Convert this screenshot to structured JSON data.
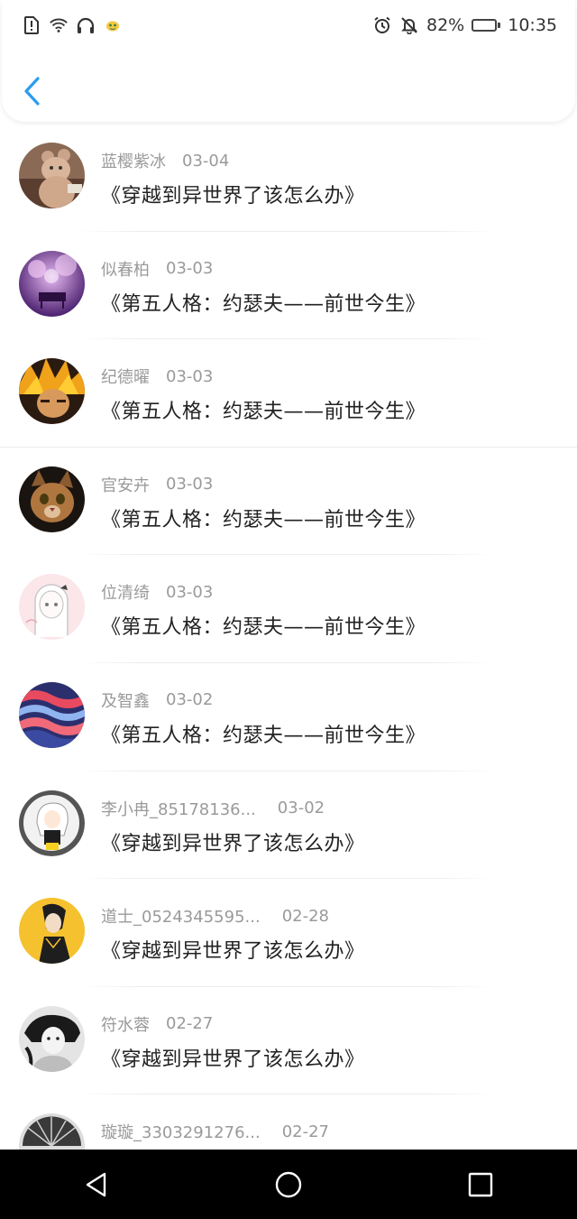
{
  "status_bar": {
    "battery": "82%",
    "battery_level": 0.82,
    "time": "10:35",
    "icons_left": [
      "sim-alert-icon",
      "wifi-icon",
      "headphones-icon",
      "app-notification-icon"
    ],
    "icons_right": [
      "alarm-icon",
      "notifications-muted-icon",
      "battery-icon"
    ]
  },
  "header": {
    "back_icon": "chevron-left-icon",
    "accent_color": "#2b9cf0"
  },
  "items": [
    {
      "name": "蓝樱紫冰",
      "date": "03-04",
      "title": "《穿越到异世界了该怎么办》",
      "avatar": "teddy-bear-avatar"
    },
    {
      "name": "似春柏",
      "date": "03-03",
      "title": "《第五人格：约瑟夫——前世今生》",
      "avatar": "purple-piano-avatar"
    },
    {
      "name": "纪德曜",
      "date": "03-03",
      "title": "《第五人格：约瑟夫——前世今生》",
      "avatar": "anime-blond-avatar"
    },
    {
      "name": "官安卉",
      "date": "03-03",
      "title": "《第五人格：约瑟夫——前世今生》",
      "avatar": "kitten-avatar"
    },
    {
      "name": "位清绮",
      "date": "03-03",
      "title": "《第五人格：约瑟夫——前世今生》",
      "avatar": "anime-girl-sketch-avatar"
    },
    {
      "name": "及智鑫",
      "date": "03-02",
      "title": "《第五人格：约瑟夫——前世今生》",
      "avatar": "wave-pattern-avatar"
    },
    {
      "name": "李小冉_85178136...",
      "date": "03-02",
      "title": "《穿越到异世界了该怎么办》",
      "avatar": "anime-white-hair-avatar"
    },
    {
      "name": "道士_0524345595...",
      "date": "02-28",
      "title": "《穿越到异世界了该怎么办》",
      "avatar": "ink-figure-avatar"
    },
    {
      "name": "符水蓉",
      "date": "02-27",
      "title": "《穿越到异世界了该怎么办》",
      "avatar": "bw-portrait-avatar"
    },
    {
      "name": "璇璇_3303291276...",
      "date": "02-27",
      "title": "",
      "avatar": "bw-fan-avatar"
    }
  ],
  "nav": {
    "back": "triangle-back-icon",
    "home": "circle-home-icon",
    "recents": "square-recents-icon"
  }
}
